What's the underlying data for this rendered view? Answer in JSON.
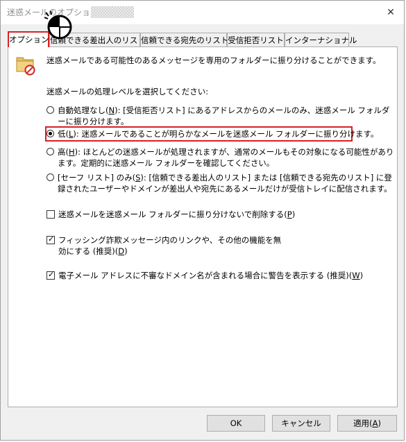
{
  "window": {
    "title": "迷惑メールのオプション -",
    "close_symbol": "✕"
  },
  "tabs": [
    {
      "label": "オプション"
    },
    {
      "label": "信頼できる差出人のリスト"
    },
    {
      "label": "信頼できる宛先のリスト"
    },
    {
      "label": "受信拒否リスト"
    },
    {
      "label": "インターナショナル"
    }
  ],
  "options": {
    "header": "迷惑メールである可能性のあるメッセージを専用のフォルダーに振り分けることができます。",
    "level_label": "迷惑メールの処理レベルを選択してください:",
    "levels": [
      {
        "prefix": "自動処理なし(",
        "key": "N",
        "suffix": "): [受信拒否リスト] にあるアドレスからのメールのみ、迷惑メール フォルダーに振り分けます。",
        "checked": false
      },
      {
        "prefix": "低(",
        "key": "L",
        "suffix": "): 迷惑メールであることが明らかなメールを迷惑メール フォルダーに振り分けます。",
        "checked": true
      },
      {
        "prefix": "高(",
        "key": "H",
        "suffix": "): ほとんどの迷惑メールが処理されますが、通常のメールもその対象になる可能性があります。定期的に迷惑メール フォルダーを確認してください。",
        "checked": false
      },
      {
        "prefix": "[セーフ リスト] のみ(",
        "key": "S",
        "suffix": "): [信頼できる差出人のリスト] または [信頼できる宛先のリスト] に登録されたユーザーやドメインが差出人や宛先にあるメールだけが受信トレイに配信されます。",
        "checked": false
      }
    ],
    "checks": [
      {
        "prefix": "迷惑メールを迷惑メール フォルダーに振り分けないで削除する(",
        "key": "P",
        "suffix": ")",
        "checked": false
      },
      {
        "prefix": "フィッシング詐欺メッセージ内のリンクや、その他の機能を無効にする (推奨)(",
        "key": "D",
        "suffix": ")",
        "checked": true
      },
      {
        "prefix": "電子メール アドレスに不審なドメイン名が含まれる場合に警告を表示する (推奨)(",
        "key": "W",
        "suffix": ")",
        "checked": true
      }
    ],
    "check_symbol": "✓"
  },
  "buttons": {
    "ok": "OK",
    "cancel": "キャンセル",
    "apply_prefix": "適用(",
    "apply_key": "A",
    "apply_suffix": ")"
  }
}
